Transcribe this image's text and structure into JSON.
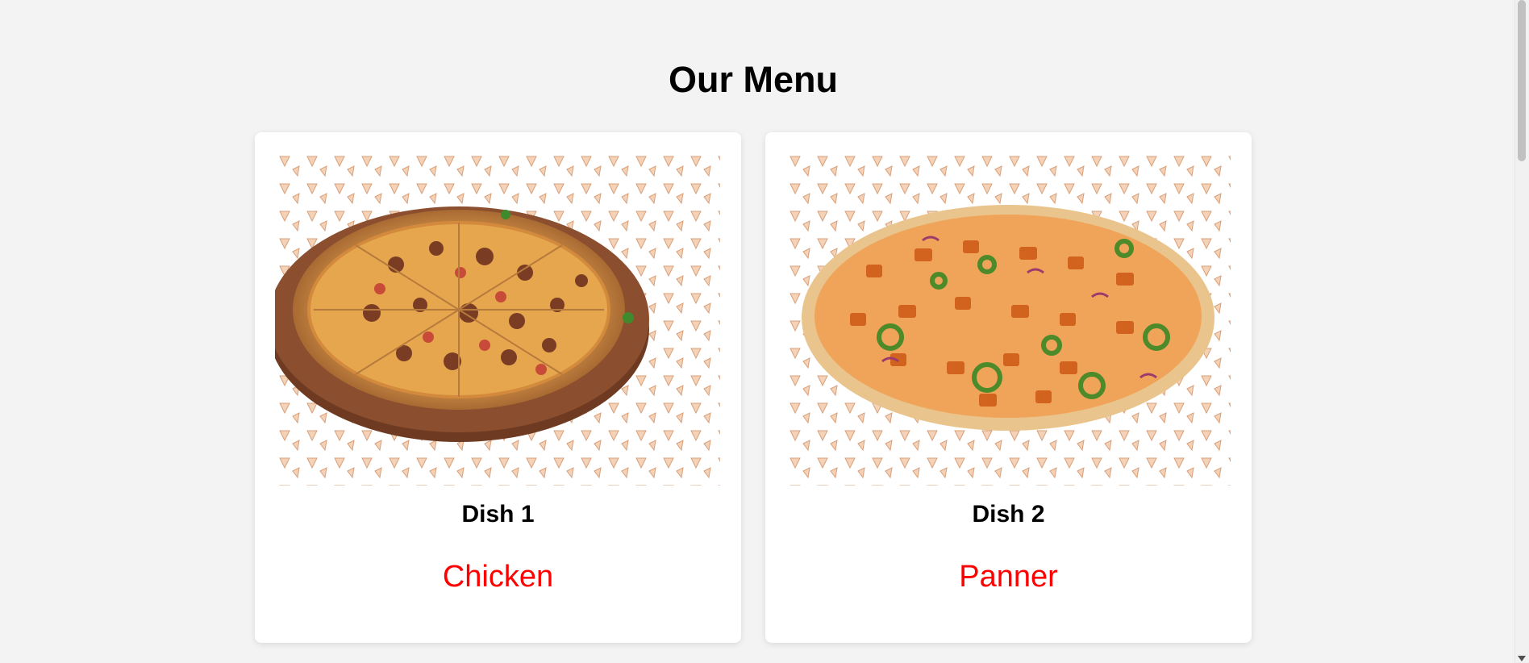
{
  "page": {
    "title": "Our Menu"
  },
  "dishes": [
    {
      "name": "Dish 1",
      "description": "Chicken",
      "image_icon": "meat-pizza-image"
    },
    {
      "name": "Dish 2",
      "description": "Panner",
      "image_icon": "paneer-pizza-image"
    }
  ],
  "colors": {
    "background": "#f3f3f3",
    "card": "#ffffff",
    "description": "#ff0000",
    "title": "#000000"
  }
}
